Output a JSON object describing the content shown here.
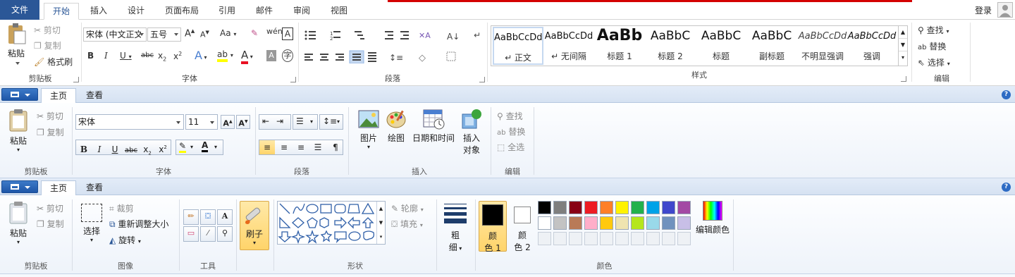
{
  "word": {
    "tabs": [
      "文件",
      "开始",
      "插入",
      "设计",
      "页面布局",
      "引用",
      "邮件",
      "审阅",
      "视图"
    ],
    "active_tab": "开始",
    "login": "登录",
    "clipboard": {
      "paste": "粘贴",
      "cut": "剪切",
      "copy": "复制",
      "format_painter": "格式刷",
      "group": "剪贴板"
    },
    "font": {
      "font_name": "宋体 (中文正文",
      "font_size": "五号",
      "group": "字体",
      "clear": "Aa"
    },
    "paragraph": {
      "group": "段落"
    },
    "styles": {
      "group": "样式",
      "items": [
        {
          "preview": "AaBbCcDd",
          "name": "↵ 正文"
        },
        {
          "preview": "AaBbCcDd",
          "name": "↵ 无间隔"
        },
        {
          "preview": "AaBb",
          "name": "标题 1"
        },
        {
          "preview": "AaBbC",
          "name": "标题 2"
        },
        {
          "preview": "AaBbC",
          "name": "标题"
        },
        {
          "preview": "AaBbC",
          "name": "副标题"
        },
        {
          "preview": "AaBbCcDd",
          "name": "不明显强调"
        },
        {
          "preview": "AaBbCcDd",
          "name": "强调"
        }
      ]
    },
    "editing": {
      "find": "查找",
      "replace": "替换",
      "select": "选择",
      "group": "编辑"
    }
  },
  "wordpad": {
    "tabs": [
      "主页",
      "查看"
    ],
    "clipboard": {
      "paste": "粘贴",
      "cut": "剪切",
      "copy": "复制",
      "group": "剪贴板"
    },
    "font": {
      "font_name": "宋体",
      "font_size": "11",
      "group": "字体"
    },
    "paragraph": {
      "group": "段落"
    },
    "insert": {
      "picture": "图片",
      "paint": "绘图",
      "datetime": "日期和时间",
      "object_line1": "插入",
      "object_line2": "对象",
      "group": "插入"
    },
    "editing": {
      "find": "查找",
      "replace": "替换",
      "select_all": "全选",
      "group": "编辑"
    }
  },
  "paint": {
    "tabs": [
      "主页",
      "查看"
    ],
    "clipboard": {
      "paste": "粘贴",
      "cut": "剪切",
      "copy": "复制",
      "group": "剪贴板"
    },
    "image": {
      "select": "选择",
      "crop": "裁剪",
      "resize": "重新调整大小",
      "rotate": "旋转",
      "group": "图像"
    },
    "tools": {
      "group": "工具"
    },
    "brushes": {
      "label": "刷子"
    },
    "shapes": {
      "outline": "轮廓",
      "fill": "填充",
      "group": "形状"
    },
    "size": {
      "line1": "粗",
      "line2": "细"
    },
    "colors": {
      "color1_line1": "颜",
      "color1_line2": "色 1",
      "color2_line1": "颜",
      "color2_line2": "色 2",
      "edit": "编辑颜色",
      "group": "颜色",
      "color1_value": "#000000",
      "color2_value": "#ffffff",
      "palette_row1": [
        "#000000",
        "#7f7f7f",
        "#880015",
        "#ed1c24",
        "#ff7f27",
        "#fff200",
        "#22b14c",
        "#00a2e8",
        "#3f48cc",
        "#a349a4"
      ],
      "palette_row2": [
        "#ffffff",
        "#c3c3c3",
        "#b97a57",
        "#ffaec9",
        "#ffc90e",
        "#efe4b0",
        "#b5e61d",
        "#99d9ea",
        "#7092be",
        "#c8bfe7"
      ]
    }
  }
}
